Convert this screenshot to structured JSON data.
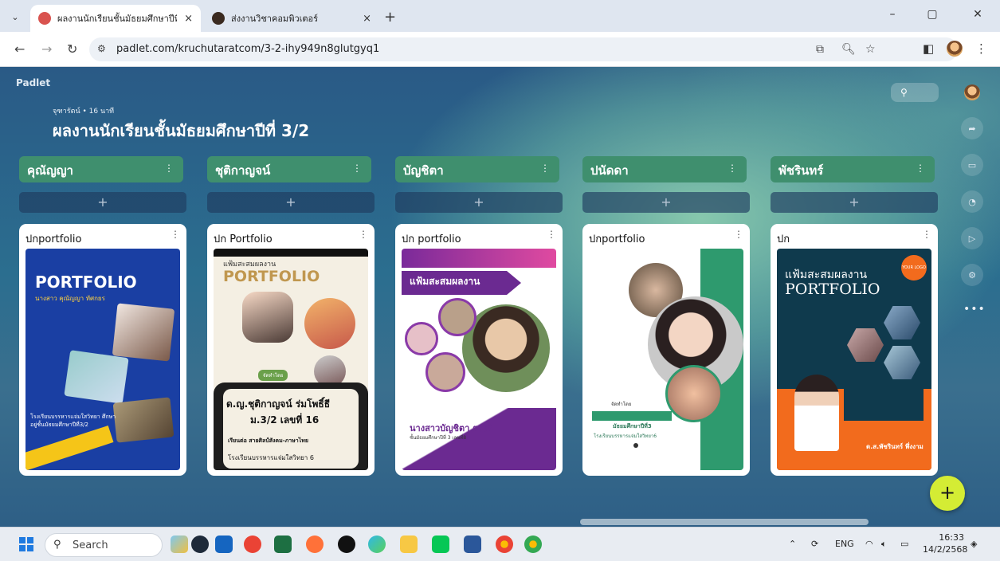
{
  "browser": {
    "tabs": [
      {
        "title": "ผลงานนักเรียนชั้นมัธยมศึกษาปีที่ 3/2",
        "active": true
      },
      {
        "title": "ส่งงานวิชาคอมพิวเตอร์",
        "active": false
      }
    ],
    "close_glyph": "×",
    "new_tab_glyph": "+",
    "url": "padlet.com/kruchutaratcom/3-2-ihy949n8glutgyq1",
    "window_controls": [
      "–",
      "▢",
      "✕"
    ]
  },
  "padlet": {
    "logo": "Padlet",
    "meta": "จุฑารัตน์ • 16 นาที",
    "title": "ผลงานนักเรียนชั้นมัธยมศึกษาปีที่ 3/2",
    "add_glyph": "+",
    "more_glyph": "⋮",
    "columns": [
      {
        "name": "คุณัญญา",
        "post_title": "ปกportfolio"
      },
      {
        "name": "ชุติกาญจน์",
        "post_title": "ปก Portfolio"
      },
      {
        "name": "บัญชิตา",
        "post_title": "ปก portfolio"
      },
      {
        "name": "ปนัดดา",
        "post_title": "ปกportfolio"
      },
      {
        "name": "พัชรินทร์",
        "post_title": "ปก"
      }
    ],
    "covers": {
      "c1": {
        "headline": "PORTFOLIO",
        "name": "นางสาว คุณัญญา ทัศกยร",
        "school": "โรงเรียนบรรหารแจ่มใสวิทยา ศึกษาอยู่ชั้นมัธยมศึกษาปีที่3/2"
      },
      "c2": {
        "top": "แฟ้มสะสมผลงาน",
        "headline": "PORTFOLIO",
        "tag": "จัดทำโดย",
        "name": "ด.ญ.ชุติกาญจน์ ร่มโพธิ์ธี",
        "cls": "ม.3/2 เลขที่ 16",
        "subject": "เรียนต่อ สายศิลป์สังคม-ภาษาไทย",
        "school": "โรงเรียนบรรหารแจ่มใสวิทยา 6"
      },
      "c3": {
        "headline": "แฟ้มสะสมผลงาน",
        "name": "นางสาวบัญชิตา ตรงดี",
        "cls": "ชั้นมัธยมศึกษาปีที่ 3 เลขที่8"
      },
      "c4": {
        "tag": "จัดทำโดย",
        "cls": "มัธยมศึกษาปีที่3",
        "school": "โรงเรียนบรรหารแจ่มใสวิทยา6"
      },
      "c5": {
        "top": "แฟ้มสะสมผลงาน",
        "headline": "PORTFOLIO",
        "badge": "YOUR LOGO",
        "name": "ด.ส.พัชรินทร์ พึ่งงาม"
      }
    }
  },
  "taskbar": {
    "search_placeholder": "Search",
    "lang": "ENG",
    "time": "16:33",
    "date": "14/2/2568"
  }
}
